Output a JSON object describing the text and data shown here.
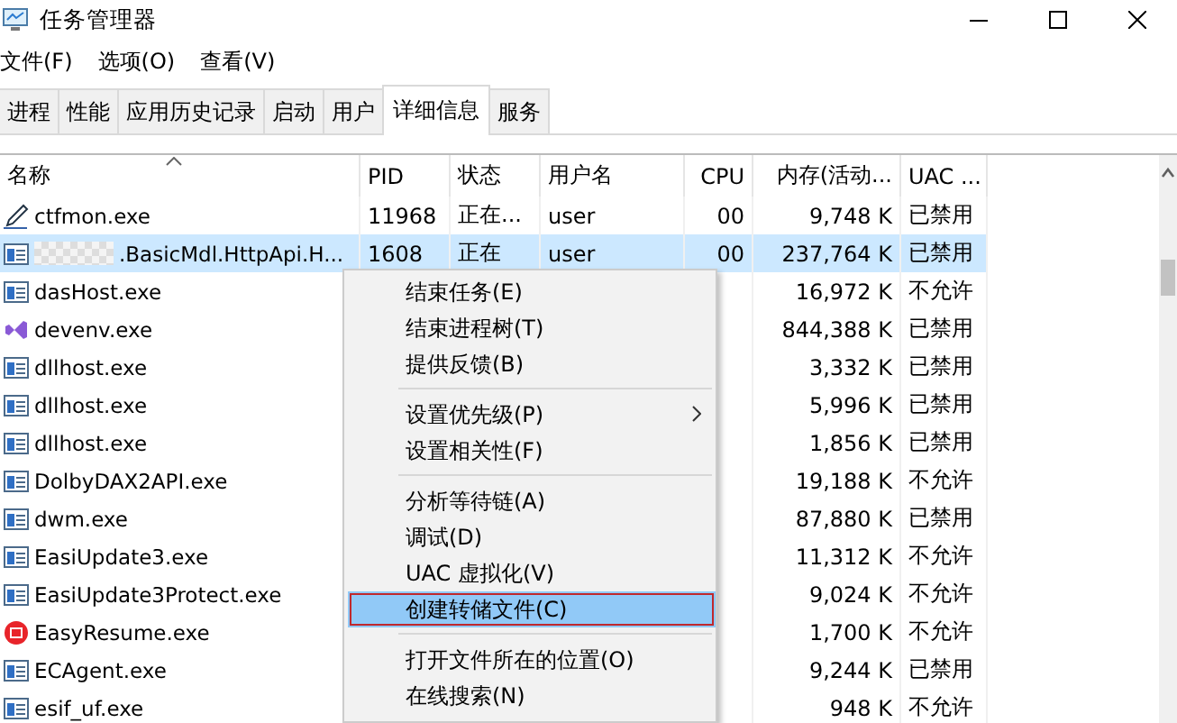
{
  "window": {
    "title": "任务管理器"
  },
  "menu_bar": [
    "文件(F)",
    "选项(O)",
    "查看(V)"
  ],
  "tabs": [
    {
      "label": "进程",
      "selected": false
    },
    {
      "label": "性能",
      "selected": false
    },
    {
      "label": "应用历史记录",
      "selected": false
    },
    {
      "label": "启动",
      "selected": false
    },
    {
      "label": "用户",
      "selected": false
    },
    {
      "label": "详细信息",
      "selected": true
    },
    {
      "label": "服务",
      "selected": false
    }
  ],
  "table": {
    "columns": [
      {
        "label": "名称",
        "sorted": true
      },
      {
        "label": "PID",
        "sorted": false
      },
      {
        "label": "状态",
        "sorted": false
      },
      {
        "label": "用户名",
        "sorted": false
      },
      {
        "label": "CPU",
        "sorted": false
      },
      {
        "label": "内存(活动...",
        "sorted": false
      },
      {
        "label": "UAC ...",
        "sorted": false
      }
    ],
    "rows": [
      {
        "kind": "pencil",
        "name": "ctfmon.exe",
        "pid": "11968",
        "status": "正在...",
        "user": "user",
        "cpu": "00",
        "memory": "9,748 K",
        "uac": "已禁用",
        "selected": false,
        "redacted": false
      },
      {
        "kind": "window",
        "name": ".BasicMdl.HttpApi.H...",
        "pid": "1608",
        "status": "正在",
        "user": "user",
        "cpu": "00",
        "memory": "237,764 K",
        "uac": "已禁用",
        "selected": true,
        "redacted": true
      },
      {
        "kind": "window",
        "name": "dasHost.exe",
        "memory": "16,972 K",
        "uac": "不允许",
        "selected": false,
        "redacted": false
      },
      {
        "kind": "studio",
        "name": "devenv.exe",
        "memory": "844,388 K",
        "uac": "已禁用",
        "selected": false,
        "redacted": false
      },
      {
        "kind": "window",
        "name": "dllhost.exe",
        "memory": "3,332 K",
        "uac": "已禁用",
        "selected": false,
        "redacted": false
      },
      {
        "kind": "window",
        "name": "dllhost.exe",
        "memory": "5,996 K",
        "uac": "已禁用",
        "selected": false,
        "redacted": false
      },
      {
        "kind": "window",
        "name": "dllhost.exe",
        "memory": "1,856 K",
        "uac": "已禁用",
        "selected": false,
        "redacted": false
      },
      {
        "kind": "window",
        "name": "DolbyDAX2API.exe",
        "memory": "19,188 K",
        "uac": "不允许",
        "selected": false,
        "redacted": false
      },
      {
        "kind": "window",
        "name": "dwm.exe",
        "memory": "87,880 K",
        "uac": "已禁用",
        "selected": false,
        "redacted": false
      },
      {
        "kind": "window",
        "name": "EasiUpdate3.exe",
        "memory": "11,312 K",
        "uac": "不允许",
        "selected": false,
        "redacted": false
      },
      {
        "kind": "window",
        "name": "EasiUpdate3Protect.exe",
        "memory": "9,024 K",
        "uac": "不允许",
        "selected": false,
        "redacted": false
      },
      {
        "kind": "resume",
        "name": "EasyResume.exe",
        "memory": "1,700 K",
        "uac": "不允许",
        "selected": false,
        "redacted": false
      },
      {
        "kind": "window",
        "name": "ECAgent.exe",
        "memory": "9,244 K",
        "uac": "已禁用",
        "selected": false,
        "redacted": false
      },
      {
        "kind": "window",
        "name": "esif_uf.exe",
        "memory": "948 K",
        "uac": "不允许",
        "selected": false,
        "redacted": false
      }
    ]
  },
  "context_menu": {
    "items": [
      {
        "kind": "item",
        "label": "结束任务(E)",
        "submenu": false,
        "selected": false,
        "outlined": false
      },
      {
        "kind": "item",
        "label": "结束进程树(T)",
        "submenu": false,
        "selected": false,
        "outlined": false
      },
      {
        "kind": "item",
        "label": "提供反馈(B)",
        "submenu": false,
        "selected": false,
        "outlined": false
      },
      {
        "kind": "separator"
      },
      {
        "kind": "item",
        "label": "设置优先级(P)",
        "submenu": true,
        "selected": false,
        "outlined": false
      },
      {
        "kind": "item",
        "label": "设置相关性(F)",
        "submenu": false,
        "selected": false,
        "outlined": false
      },
      {
        "kind": "separator"
      },
      {
        "kind": "item",
        "label": "分析等待链(A)",
        "submenu": false,
        "selected": false,
        "outlined": false
      },
      {
        "kind": "item",
        "label": "调试(D)",
        "submenu": false,
        "selected": false,
        "outlined": false
      },
      {
        "kind": "item",
        "label": "UAC 虚拟化(V)",
        "submenu": false,
        "selected": false,
        "outlined": false
      },
      {
        "kind": "item",
        "label": "创建转储文件(C)",
        "submenu": false,
        "selected": true,
        "outlined": true
      },
      {
        "kind": "separator"
      },
      {
        "kind": "item",
        "label": "打开文件所在的位置(O)",
        "submenu": false,
        "selected": false,
        "outlined": false
      },
      {
        "kind": "item",
        "label": "在线搜索(N)",
        "submenu": false,
        "selected": false,
        "outlined": false
      }
    ]
  }
}
